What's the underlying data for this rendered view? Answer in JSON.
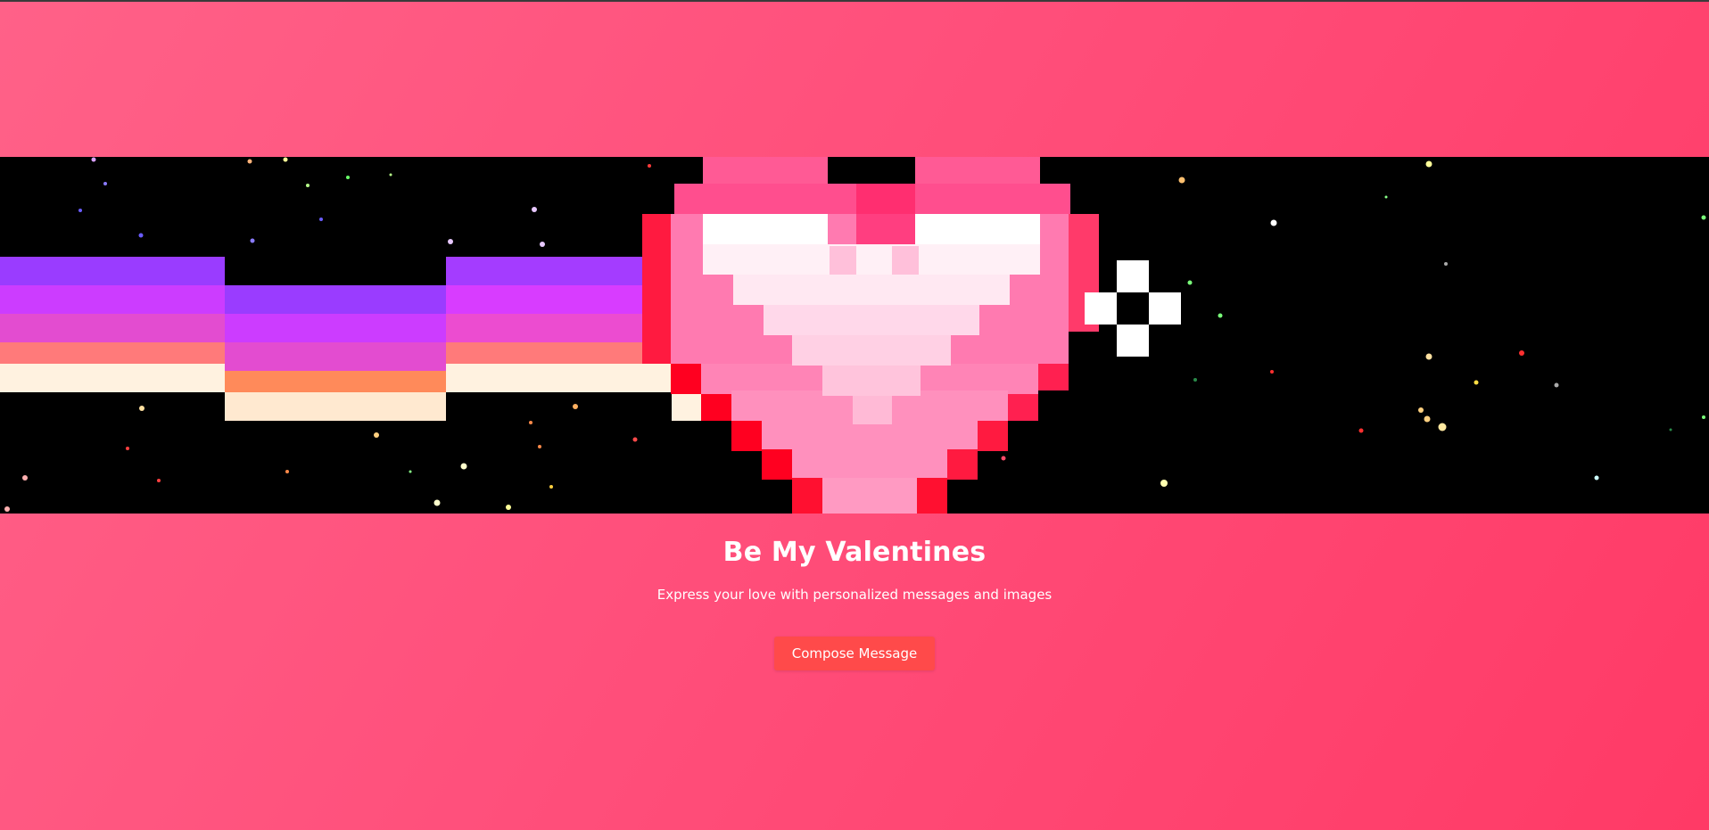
{
  "hero": {
    "title": "Be My Valentines",
    "subtitle": "Express your love with personalized messages and images",
    "button_label": "Compose Message"
  },
  "banner": {
    "icon": "pixel-heart-rainbow-trail"
  },
  "colors": {
    "background_start": "#ff6188",
    "background_end": "#ff3a66",
    "button": "#ff4a4a",
    "text": "#ffffff"
  }
}
